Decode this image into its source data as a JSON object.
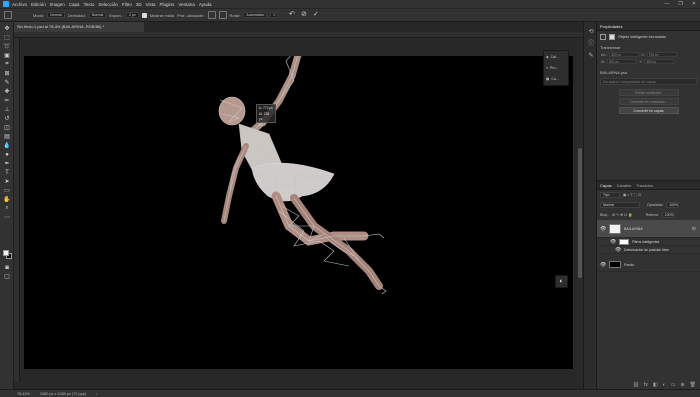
{
  "menu": {
    "items": [
      "Archivo",
      "Edición",
      "Imagen",
      "Capa",
      "Texto",
      "Selección",
      "Filtro",
      "3D",
      "Vista",
      "Plugins",
      "Ventana",
      "Ayuda"
    ],
    "window_controls": [
      "—",
      "❐",
      "✕"
    ]
  },
  "options": {
    "modo_label": "Modo:",
    "modo_value": "Normal",
    "densidad_label": "Densidad:",
    "densidad_value": "Normal",
    "expan_label": "Expan.:",
    "expan_value": "2 px",
    "mostrar_malla_label": "Mostrar malla",
    "prof_label": "Prof. ubicación:",
    "rotar_label": "Rotar:",
    "rotar_value": "Automático",
    "angle_value": "0",
    "undo": "↶",
    "cancel": "⊘",
    "confirm": "✓"
  },
  "document": {
    "tab_title": "Sin título-1.psd al 78,4% (BAILARINA, RGB/8#) *"
  },
  "canvas": {
    "overlay_line1": "A: 772 px",
    "overlay_line2": "Al: 228 px",
    "overlay_line3": "20,6°",
    "panel_labels": [
      "Cal...",
      "Pro...",
      "Ca..."
    ]
  },
  "status": {
    "zoom": "78,43%",
    "dims": "1080 px x 1080 px (72 ppp)"
  },
  "properties": {
    "title": "Propiedades",
    "subtitle": "Objeto inteligente incrustado",
    "transform_label": "Transformar",
    "an_label": "An.:",
    "an_value": "620 px",
    "x_label": "X:",
    "x_value": "794 px",
    "al_label": "Al:",
    "al_value": "691 px",
    "y_label": "Y:",
    "y_value": "389 px",
    "file_name": "BAILARINA.psd",
    "comp_placeholder": "No aplicar composición de capas",
    "buttons": [
      "Editar contenido",
      "Convertir en enlazado...",
      "Convertir en capas"
    ]
  },
  "layers": {
    "tabs": [
      "Capas",
      "Canales",
      "Trazados"
    ],
    "blend_mode": "Normal",
    "opacity_label": "Opacidad:",
    "opacity_value": "100%",
    "lock_label": "Bloq.:",
    "fill_label": "Relleno:",
    "fill_value": "100%",
    "kind": "Tipo",
    "items": [
      {
        "name": "BAILARINA",
        "selected": true
      },
      {
        "name": "Filtros inteligentes",
        "sub": true
      },
      {
        "name": "Deformación de posición libre",
        "sub": true
      },
      {
        "name": "Fondo"
      }
    ]
  }
}
